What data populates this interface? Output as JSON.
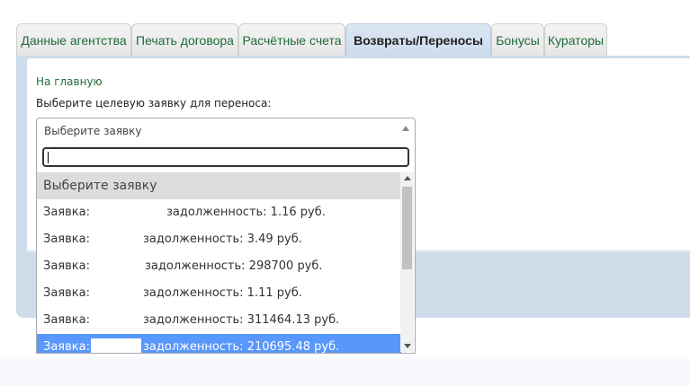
{
  "tabs": [
    {
      "label": "Данные агентства",
      "active": false
    },
    {
      "label": "Печать договора",
      "active": false
    },
    {
      "label": "Расчётные счета",
      "active": false
    },
    {
      "label": "Возвраты/Переносы",
      "active": true
    },
    {
      "label": "Бонусы",
      "active": false
    },
    {
      "label": "Кураторы",
      "active": false
    }
  ],
  "home_link": "На главную",
  "select_label": "Выберите целевую заявку для переноса:",
  "select": {
    "value": "Выберите заявку",
    "search_value": ""
  },
  "options": [
    {
      "text": "Выберите заявку",
      "state": "placeholder"
    },
    {
      "prefix": "Заявка:",
      "debt": "задолженность: 1.16 руб.",
      "state": "normal"
    },
    {
      "prefix": "Заявка:",
      "debt": "задолженность: 3.49 руб.",
      "state": "normal"
    },
    {
      "prefix": "Заявка:",
      "debt": "задолженность: 298700 руб.",
      "state": "normal"
    },
    {
      "prefix": "Заявка:",
      "debt": "задолженность: 1.11 руб.",
      "state": "normal"
    },
    {
      "prefix": "Заявка:",
      "debt": "задолженность: 311464.13 руб.",
      "state": "normal"
    },
    {
      "prefix": "Заявка:",
      "debt": "задолженность: 210695.48 руб.",
      "state": "highlighted"
    }
  ]
}
